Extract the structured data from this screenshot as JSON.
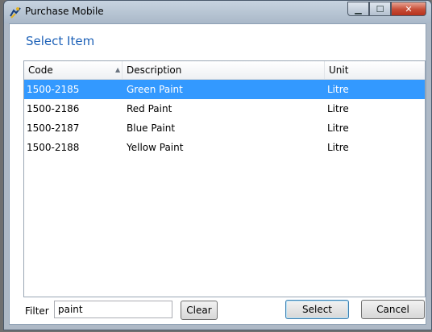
{
  "window": {
    "title": "Purchase Mobile",
    "buttons": {
      "minimize": "▁",
      "maximize": "☐",
      "close": "✕"
    }
  },
  "dialog": {
    "heading": "Select Item"
  },
  "table": {
    "columns": [
      "Code",
      "Description",
      "Unit"
    ],
    "sorted_column": "Description",
    "sort_direction": "ascending",
    "rows": [
      {
        "code": "1500-2185",
        "description": "Green Paint",
        "unit": "Litre",
        "selected": true
      },
      {
        "code": "1500-2186",
        "description": "Red Paint",
        "unit": "Litre",
        "selected": false
      },
      {
        "code": "1500-2187",
        "description": "Blue Paint",
        "unit": "Litre",
        "selected": false
      },
      {
        "code": "1500-2188",
        "description": "Yellow Paint",
        "unit": "Litre",
        "selected": false
      }
    ]
  },
  "filter": {
    "label": "Filter",
    "value": "paint",
    "clear_label": "Clear"
  },
  "actions": {
    "select_label": "Select",
    "cancel_label": "Cancel"
  },
  "colors": {
    "accent": "#1e62b8",
    "selection": "#3399ff"
  }
}
